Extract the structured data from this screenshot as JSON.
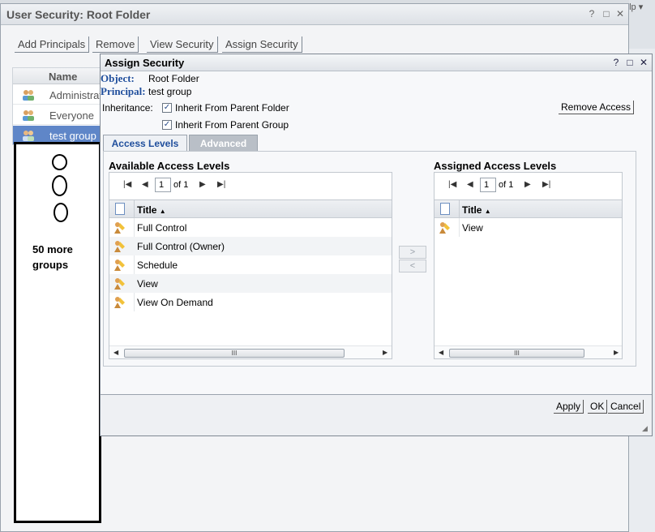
{
  "background": {
    "help_text": "elp ▾"
  },
  "outer_window": {
    "title": "User Security: Root Folder",
    "toolbar": [
      "Add Principals",
      "Remove",
      "View Security",
      "Assign Security"
    ],
    "table": {
      "header": "Name",
      "rows": [
        {
          "label": "Administrat",
          "selected": false
        },
        {
          "label": "Everyone",
          "selected": false
        },
        {
          "label": "test group",
          "selected": true
        }
      ]
    }
  },
  "annotation": {
    "text": "50 more groups"
  },
  "dialog": {
    "title": "Assign Security",
    "controls": [
      "?",
      "□",
      "✕"
    ],
    "object_label": "Object:",
    "object_value": "Root Folder",
    "principal_label": "Principal:",
    "principal_value": "test group",
    "inheritance_label": "Inheritance:",
    "inherit_folder": {
      "label": "Inherit From Parent Folder",
      "checked": true
    },
    "inherit_group": {
      "label": "Inherit From Parent Group",
      "checked": true
    },
    "remove_access": "Remove Access",
    "tabs": [
      {
        "label": "Access Levels",
        "active": true
      },
      {
        "label": "Advanced",
        "active": false
      }
    ],
    "available": {
      "title": "Available Access Levels",
      "page": "1",
      "of": "of 1",
      "column": "Title",
      "rows": [
        "Full Control",
        "Full Control (Owner)",
        "Schedule",
        "View",
        "View On Demand"
      ]
    },
    "assigned": {
      "title": "Assigned Access Levels",
      "page": "1",
      "of": "of 1",
      "column": "Title",
      "rows": [
        "View"
      ]
    },
    "move_right": ">",
    "move_left": "<",
    "scroll_grip": "III",
    "footer": {
      "apply": "Apply",
      "ok": "OK",
      "cancel": "Cancel"
    }
  },
  "colors": {
    "accent": "#1f4e9c",
    "selection": "#5f86c8"
  }
}
